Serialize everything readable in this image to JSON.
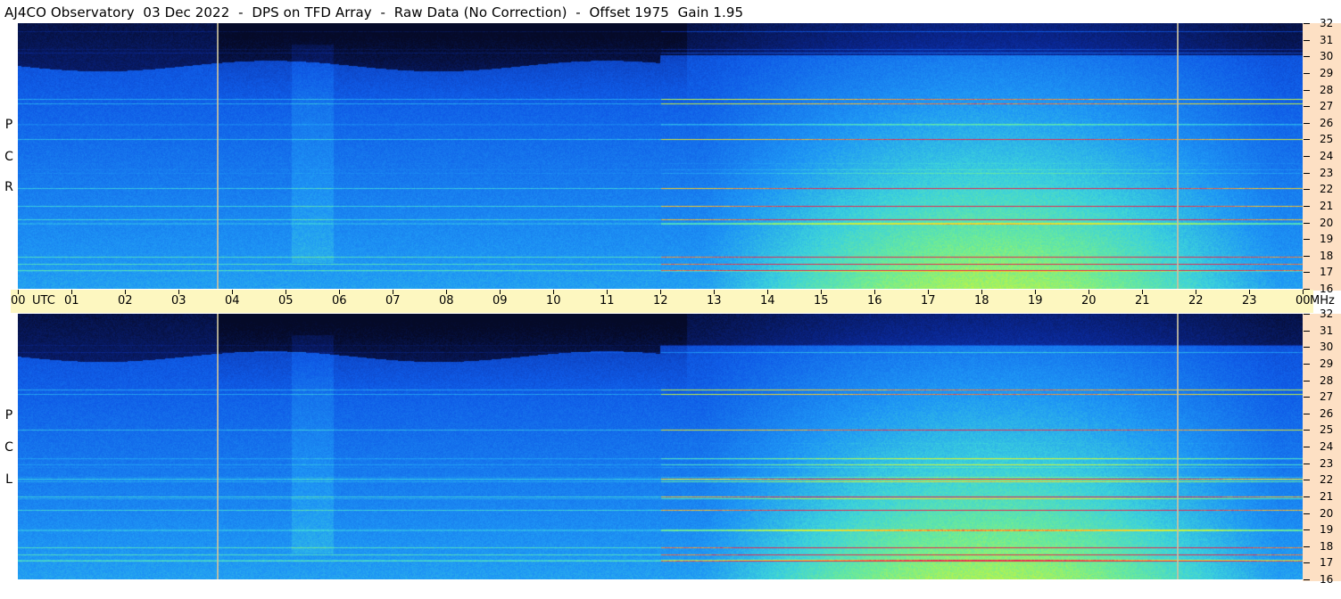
{
  "title": "AJ4CO Observatory  03 Dec 2022  -  DPS on TFD Array  -  Raw Data (No Correction)  -  Offset 1975  Gain 1.95",
  "panels": [
    {
      "id": "rcp",
      "label_letters": [
        "R",
        "C",
        "P"
      ]
    },
    {
      "id": "lcp",
      "label_letters": [
        "L",
        "C",
        "P"
      ]
    }
  ],
  "frequency_axis": {
    "unit": "MHz",
    "labels": [
      "32",
      "31",
      "30",
      "29",
      "28",
      "27",
      "26",
      "25",
      "24",
      "23",
      "22",
      "21",
      "20",
      "19",
      "18",
      "17",
      "16"
    ]
  },
  "time_axis": {
    "labels": [
      "00",
      "01",
      "02",
      "03",
      "04",
      "05",
      "06",
      "07",
      "08",
      "09",
      "10",
      "11",
      "12",
      "13",
      "14",
      "15",
      "16",
      "17",
      "18",
      "19",
      "20",
      "21",
      "22",
      "23",
      "00"
    ],
    "utc_label": "UTC",
    "end_unit": "MHz"
  },
  "colors": {
    "background_dark": "#0a1a55",
    "axis_freq_bg": "#fde0c4",
    "axis_time_bg": "#fdf7c0",
    "marker": "#c8c0a0"
  }
}
